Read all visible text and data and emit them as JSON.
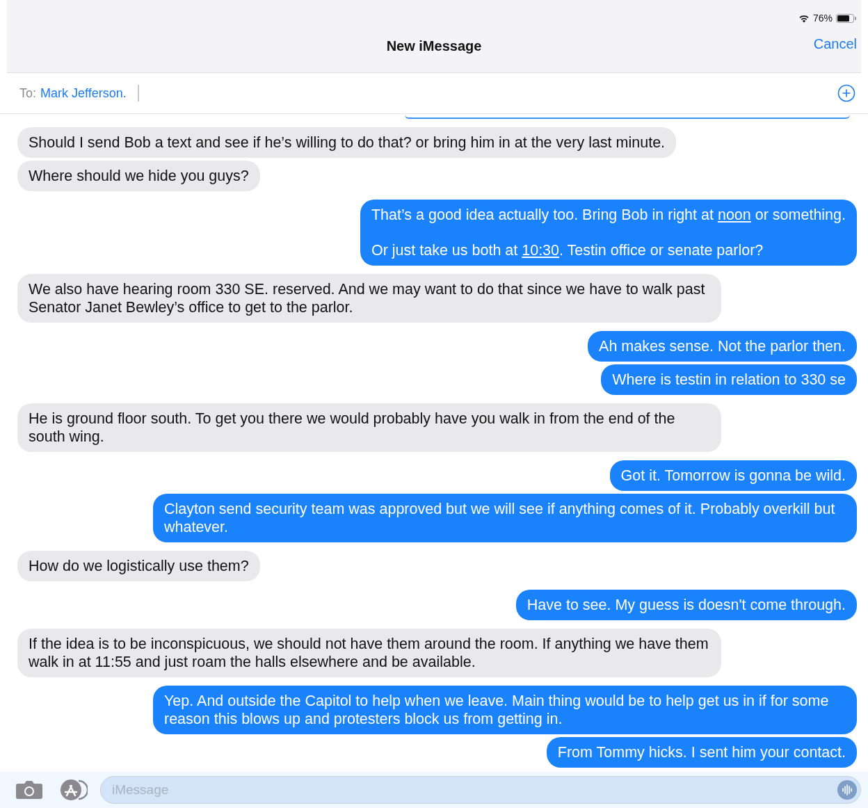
{
  "status_bar": {
    "battery": "76%"
  },
  "nav": {
    "title": "New iMessage",
    "cancel": "Cancel"
  },
  "to": {
    "label": "To:",
    "recipient": "Mark Jefferson."
  },
  "messages": [
    {
      "kind": "sent-partial"
    },
    {
      "kind": "received",
      "text": "Should I send Bob a text and see if he’s willing to do that? or bring him in at the very last minute."
    },
    {
      "kind": "received",
      "text": "Where should we hide you guys?"
    },
    {
      "kind": "sent",
      "paragraphs": [
        [
          {
            "kind": "text",
            "text": "That’s a good idea actually too. Bring Bob in right at "
          },
          {
            "kind": "link",
            "text": "noon"
          },
          {
            "kind": "text",
            "text": " or something."
          }
        ],
        [
          {
            "kind": "text",
            "text": "Or just take us both at "
          },
          {
            "kind": "link",
            "text": "10:30"
          },
          {
            "kind": "text",
            "text": ". Testin office or senate parlor?"
          }
        ]
      ]
    },
    {
      "kind": "received",
      "text": "We also have hearing room 330 SE. reserved. And we may want to do that since we have to walk past Senator Janet Bewley’s office to get to the parlor."
    },
    {
      "kind": "sent",
      "text": "Ah makes sense. Not the parlor then."
    },
    {
      "kind": "sent",
      "text": "Where is testin in relation to 330 se"
    },
    {
      "kind": "received",
      "text": "He is ground floor south. To get you there we would probably have you walk in from the end of the south wing."
    },
    {
      "kind": "sent",
      "text": "Got it. Tomorrow is gonna be wild."
    },
    {
      "kind": "sent",
      "text": "Clayton send security team was approved but we will see if anything comes of it. Probably overkill but whatever."
    },
    {
      "kind": "received",
      "text": "How do we logistically use them?"
    },
    {
      "kind": "sent",
      "text": "Have to see. My guess is doesn't come through."
    },
    {
      "kind": "received",
      "text": "If the idea is to be inconspicuous, we should not have them around the room. If anything we have them walk in at 11:55 and just roam the halls elsewhere and be available."
    },
    {
      "kind": "sent",
      "text": "Yep. And outside the Capitol to help when we leave. Main thing would be to help get us in if for some reason this blows up and protesters block us from getting in."
    },
    {
      "kind": "sent",
      "text": "From Tommy hicks. I sent him your contact."
    }
  ],
  "composer": {
    "placeholder": "iMessage"
  }
}
